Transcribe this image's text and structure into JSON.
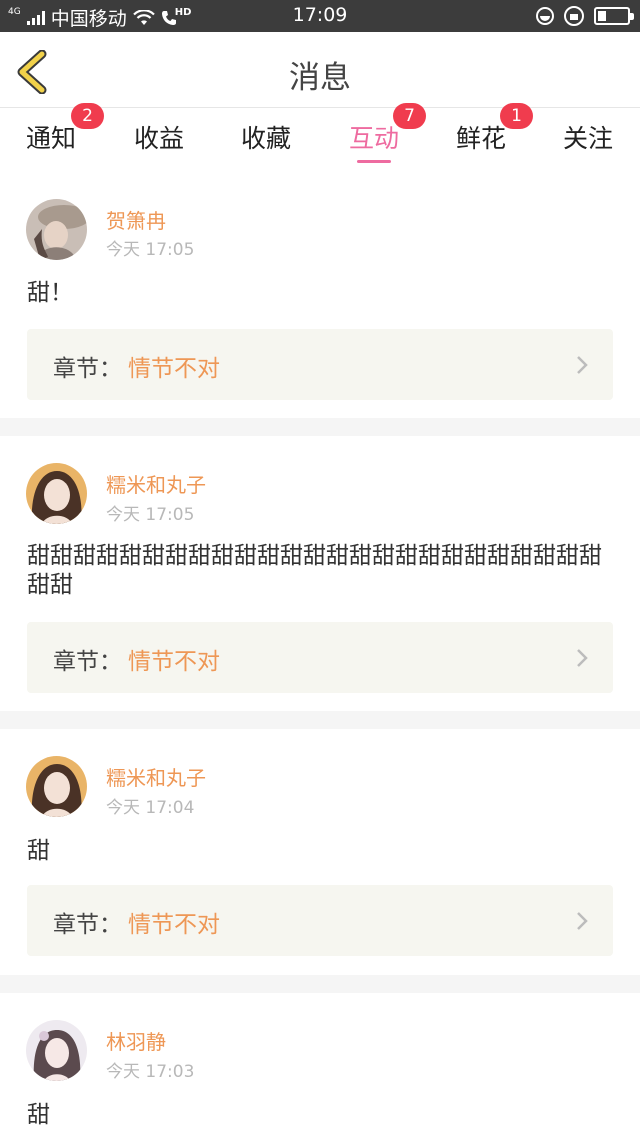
{
  "status_bar": {
    "network": "4G",
    "carrier": "中国移动",
    "hd": "HD",
    "time": "17:09"
  },
  "header": {
    "title": "消息"
  },
  "tabs": [
    {
      "label": "通知",
      "badge": "2",
      "active": false
    },
    {
      "label": "收益",
      "badge": "",
      "active": false
    },
    {
      "label": "收藏",
      "badge": "",
      "active": false
    },
    {
      "label": "互动",
      "badge": "7",
      "active": true
    },
    {
      "label": "鲜花",
      "badge": "1",
      "active": false
    },
    {
      "label": "关注",
      "badge": "",
      "active": false
    }
  ],
  "colors": {
    "accent_pink": "#ee6ba0",
    "username_orange": "#ee9755",
    "badge_red": "#f03c4e",
    "status_bar_bg": "#3c3c3c"
  },
  "messages": [
    {
      "user": "贺箫冉",
      "time": "今天 17:05",
      "content": "甜！",
      "chapter_label": "章节：",
      "chapter_name": "情节不对"
    },
    {
      "user": "糯米和丸子",
      "time": "今天 17:05",
      "content": "甜甜甜甜甜甜甜甜甜甜甜甜甜甜甜甜甜甜甜甜甜甜甜甜甜甜甜",
      "chapter_label": "章节：",
      "chapter_name": "情节不对"
    },
    {
      "user": "糯米和丸子",
      "time": "今天 17:04",
      "content": "甜",
      "chapter_label": "章节：",
      "chapter_name": "情节不对"
    },
    {
      "user": "林羽静",
      "time": "今天 17:03",
      "content": "甜"
    }
  ]
}
